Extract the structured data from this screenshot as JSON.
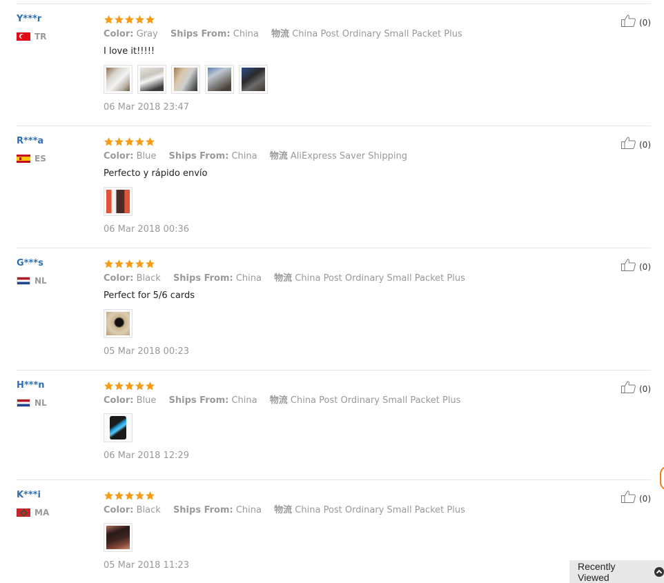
{
  "labels": {
    "color": "Color:",
    "ships_from": "Ships From:",
    "logistics": "物流"
  },
  "colors": {
    "star": "#f49b17",
    "username": "#2f6fb5",
    "muted": "#999999"
  },
  "reviews": [
    {
      "user": "Y***r",
      "country": "TR",
      "rating": 5,
      "color": "Gray",
      "ships_from": "China",
      "logistics": "China Post Ordinary Small Packet Plus",
      "comment": "I love it!!!!!",
      "thumb_count": 5,
      "date": "06 Mar 2018 23:47",
      "helpful": "(0)"
    },
    {
      "user": "R***a",
      "country": "ES",
      "rating": 5,
      "color": "Blue",
      "ships_from": "China",
      "logistics": "AliExpress Saver Shipping",
      "comment": "Perfecto y rápido envío",
      "thumb_count": 1,
      "date": "06 Mar 2018 00:36",
      "helpful": "(0)"
    },
    {
      "user": "G***s",
      "country": "NL",
      "rating": 5,
      "color": "Black",
      "ships_from": "China",
      "logistics": "China Post Ordinary Small Packet Plus",
      "comment": "Perfect for 5/6 cards",
      "thumb_count": 1,
      "date": "05 Mar 2018 00:23",
      "helpful": "(0)"
    },
    {
      "user": "H***n",
      "country": "NL",
      "rating": 5,
      "color": "Blue",
      "ships_from": "China",
      "logistics": "China Post Ordinary Small Packet Plus",
      "comment": "",
      "thumb_count": 1,
      "date": "06 Mar 2018 12:29",
      "helpful": "(0)"
    },
    {
      "user": "K***i",
      "country": "MA",
      "rating": 5,
      "color": "Black",
      "ships_from": "China",
      "logistics": "China Post Ordinary Small Packet Plus",
      "comment": "",
      "thumb_count": 1,
      "date": "05 Mar 2018 11:23",
      "helpful": "(0)"
    }
  ],
  "recently_viewed": "Recently Viewed"
}
